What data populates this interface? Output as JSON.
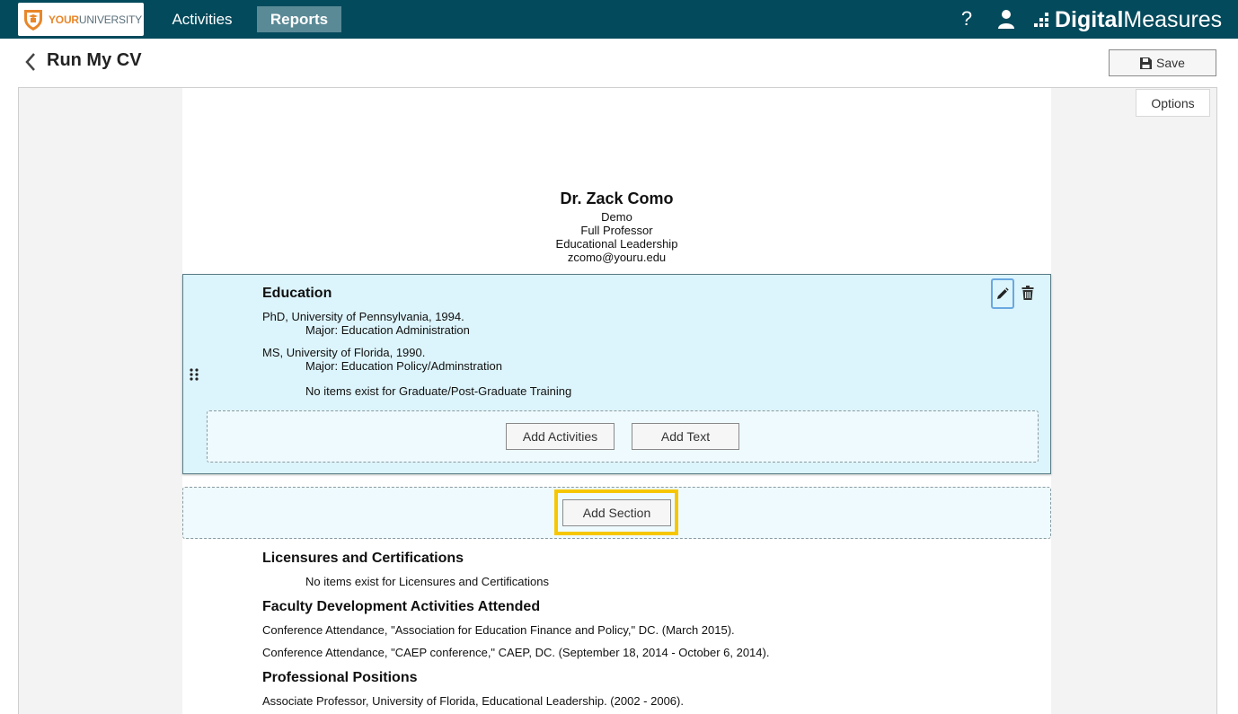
{
  "nav": {
    "logo_part1": "YOUR",
    "logo_part2": "UNIVERSITY",
    "tabs": [
      {
        "label": "Activities",
        "active": false
      },
      {
        "label": "Reports",
        "active": true
      }
    ],
    "help": "?",
    "brand_bold": "Digital",
    "brand_regular": "Measures",
    "bar_color": "#034a5c"
  },
  "header": {
    "title": "Run My CV",
    "save_label": "Save"
  },
  "canvas": {
    "options_label": "Options"
  },
  "cv": {
    "name": "Dr. Zack Como",
    "lines": [
      "Demo",
      "Full Professor",
      "Educational Leadership",
      "zcomo@youru.edu"
    ],
    "sections": [
      {
        "title": "Education",
        "entries": [
          {
            "line": "PhD, University of Pennsylvania, 1994.",
            "detail": "Major: Education Administration"
          },
          {
            "line": "MS, University of Florida, 1990.",
            "detail": "Major: Education Policy/Adminstration"
          }
        ],
        "empty_note": "No items exist for Graduate/Post-Graduate Training",
        "add_activities_label": "Add Activities",
        "add_text_label": "Add Text"
      },
      {
        "title": "Licensures and Certifications",
        "empty_note": "No items exist for Licensures and Certifications"
      },
      {
        "title": "Faculty Development Activities Attended",
        "entries": [
          "Conference Attendance, \"Association for Education Finance and Policy,\" DC. (March 2015).",
          "Conference Attendance, \"CAEP conference,\" CAEP, DC. (September 18, 2014 - October 6, 2014)."
        ]
      },
      {
        "title": "Professional Positions",
        "entries": [
          "Associate Professor, University of Florida, Educational Leadership. (2002 - 2006)."
        ]
      }
    ],
    "add_section_label": "Add Section"
  }
}
